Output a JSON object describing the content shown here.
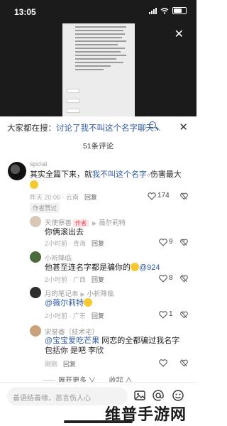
{
  "status": {
    "time": "13:05"
  },
  "video": {
    "close_icon": "close-icon"
  },
  "search": {
    "prefix": "大家都在搜：",
    "query": "讨论了我不叫这个名字聊天...",
    "close": "✕"
  },
  "comment_count": "51条评论",
  "comments": [
    {
      "user": "spcial",
      "text_a": "其实全篇下来，就",
      "text_link": "我不叫这个名字",
      "text_b": "伤害最大",
      "time_loc": "昨天 20:06 · 云南",
      "reply": "回复",
      "likes": "174",
      "badge": "作者赞过"
    },
    {
      "user": "天使察善",
      "author_tag": "作者",
      "reply_to": "薇尔莉特",
      "text": "你俩滚出去",
      "time_loc": "2小时前 · 青海",
      "reply": "回复",
      "likes": "9"
    },
    {
      "user": "小祈降临",
      "text": "他甚至连名字都是骗你的",
      "mention": "@924",
      "time_loc": "2小时前 · 广西",
      "reply": "回复",
      "likes": "8"
    },
    {
      "user": "月的笔记本",
      "reply_to": "小祈降临",
      "mention": "@薇尔莉特",
      "time_loc": "2小时前 · 广东",
      "reply": "回复",
      "likes": "1"
    },
    {
      "user": "宋誉睿（技术宅）",
      "mention": "@宝宝爱吃芒果",
      "text": "网恋的全都骗过我名字 包括你 是吧 李欣",
      "time_loc": "刚刚",
      "reply": "回复"
    }
  ],
  "expand": {
    "more": "展开更多",
    "collapse": "收起"
  },
  "input": {
    "placeholder": "善语结善缘，恶言伤人心"
  },
  "watermark": "维普手游网"
}
